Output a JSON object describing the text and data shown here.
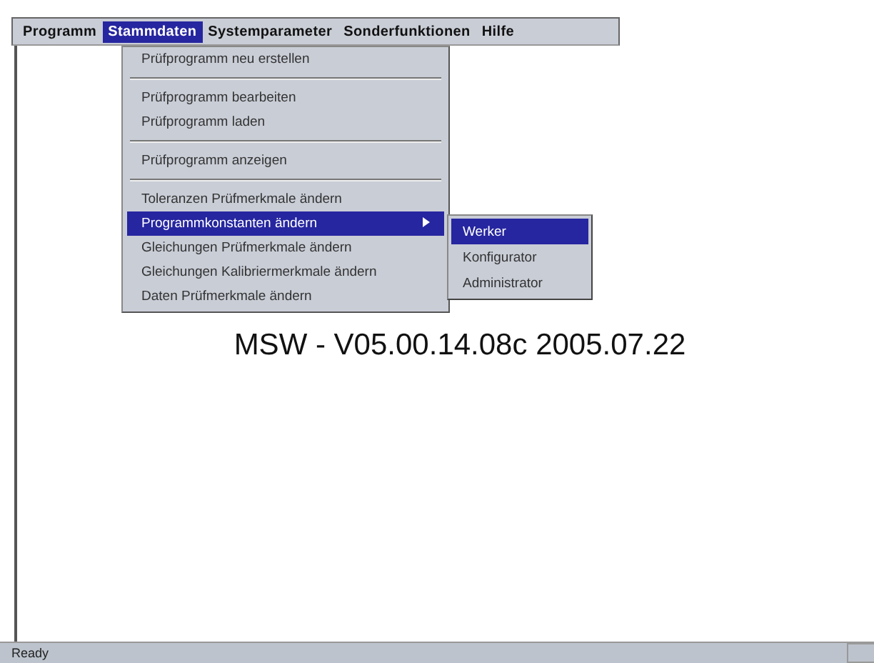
{
  "menubar": [
    {
      "label": "Programm",
      "selected": false
    },
    {
      "label": "Stammdaten",
      "selected": true
    },
    {
      "label": "Systemparameter",
      "selected": false
    },
    {
      "label": "Sonderfunktionen",
      "selected": false
    },
    {
      "label": "Hilfe",
      "selected": false
    }
  ],
  "dropdown": [
    {
      "kind": "item",
      "label": "Prüfprogramm neu erstellen",
      "selected": false,
      "submenu": false
    },
    {
      "kind": "separator"
    },
    {
      "kind": "item",
      "label": "Prüfprogramm bearbeiten",
      "selected": false,
      "submenu": false
    },
    {
      "kind": "item",
      "label": "Prüfprogramm laden",
      "selected": false,
      "submenu": false
    },
    {
      "kind": "separator"
    },
    {
      "kind": "item",
      "label": "Prüfprogramm anzeigen",
      "selected": false,
      "submenu": false
    },
    {
      "kind": "separator"
    },
    {
      "kind": "item",
      "label": "Toleranzen Prüfmerkmale ändern",
      "selected": false,
      "submenu": false
    },
    {
      "kind": "item",
      "label": "Programmkonstanten ändern",
      "selected": true,
      "submenu": true
    },
    {
      "kind": "item",
      "label": "Gleichungen Prüfmerkmale ändern",
      "selected": false,
      "submenu": false
    },
    {
      "kind": "item",
      "label": "Gleichungen Kalibriermerkmale ändern",
      "selected": false,
      "submenu": false
    },
    {
      "kind": "item",
      "label": "Daten Prüfmerkmale ändern",
      "selected": false,
      "submenu": false
    }
  ],
  "submenu": [
    {
      "label": "Werker",
      "selected": true
    },
    {
      "label": "Konfigurator",
      "selected": false
    },
    {
      "label": "Administrator",
      "selected": false
    }
  ],
  "version_text": "MSW - V05.00.14.08c 2005.07.22",
  "status_bar": "Ready"
}
